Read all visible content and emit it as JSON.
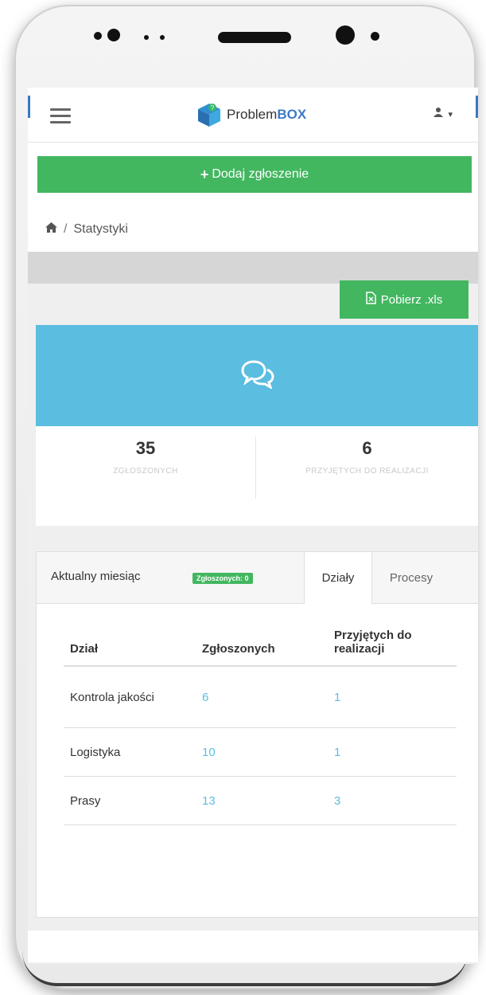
{
  "brand": {
    "name_prefix": "Problem",
    "name_suffix": "BOX"
  },
  "header": {
    "user_icon": "user-icon",
    "user_caret": "▾",
    "menu_icon": "hamburger-icon"
  },
  "actions": {
    "add_label": "Dodaj zgłoszenie",
    "add_icon": "plus-icon",
    "download_label": "Pobierz .xls",
    "download_icon": "excel-file-icon"
  },
  "breadcrumb": {
    "home_icon": "home-icon",
    "separator": "/",
    "current": "Statystyki"
  },
  "stats": {
    "icon": "comments-icon",
    "reported": {
      "value": "35",
      "label": "ZGŁOSZONYCH"
    },
    "accepted": {
      "value": "6",
      "label": "PRZYJĘTYCH DO REALIZACJI"
    }
  },
  "panel": {
    "title": "Aktualny miesiąc",
    "badge": "Zgłoszonych: 0",
    "tabs": [
      {
        "label": "Działy",
        "active": true
      },
      {
        "label": "Procesy",
        "active": false
      }
    ]
  },
  "table": {
    "headers": {
      "dept": "Dział",
      "reported": "Zgłoszonych",
      "accepted": "Przyjętych do realizacji"
    },
    "rows": [
      {
        "dept": "Kontrola jakości",
        "reported": "6",
        "accepted": "1"
      },
      {
        "dept": "Logistyka",
        "reported": "10",
        "accepted": "1"
      },
      {
        "dept": "Prasy",
        "reported": "13",
        "accepted": "3"
      }
    ]
  },
  "colors": {
    "green": "#42b760",
    "blue": "#5bbde0",
    "brand_blue": "#3f7ac6"
  }
}
